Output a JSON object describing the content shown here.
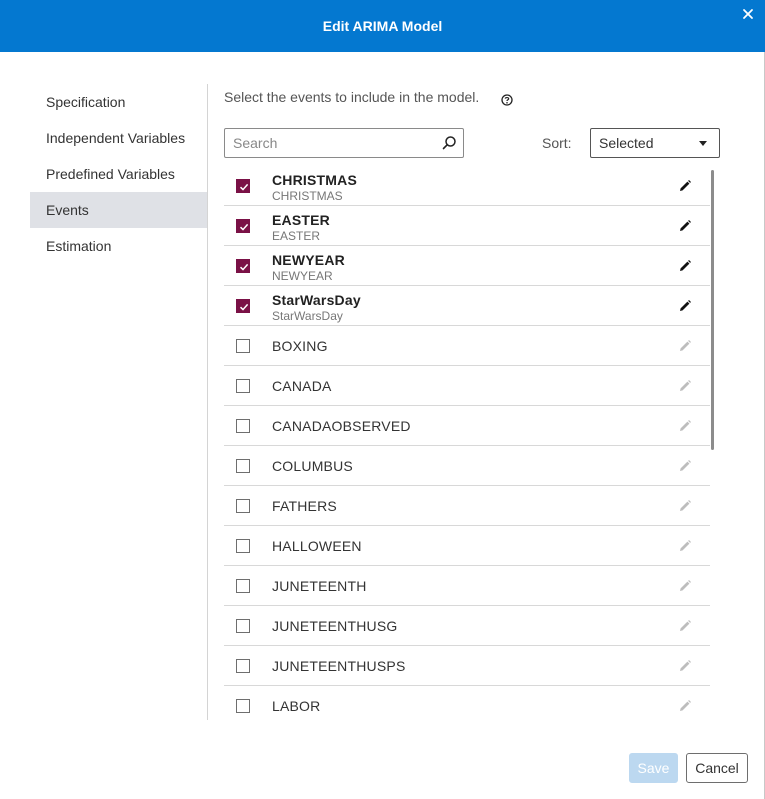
{
  "dialog": {
    "title": "Edit ARIMA Model",
    "accent_color": "#0478d0"
  },
  "nav": {
    "items": [
      {
        "label": "Specification",
        "active": false
      },
      {
        "label": "Independent Variables",
        "active": false
      },
      {
        "label": "Predefined Variables",
        "active": false
      },
      {
        "label": "Events",
        "active": true
      },
      {
        "label": "Estimation",
        "active": false
      }
    ]
  },
  "events_panel": {
    "instruction": "Select the events to include in the model.",
    "help_icon": "help-icon",
    "search": {
      "placeholder": "Search",
      "value": ""
    },
    "sort": {
      "label": "Sort:",
      "selected": "Selected"
    },
    "checkbox_color": "#7a1146",
    "rows": [
      {
        "name": "CHRISTMAS",
        "sub": "CHRISTMAS",
        "checked": true
      },
      {
        "name": "EASTER",
        "sub": "EASTER",
        "checked": true
      },
      {
        "name": "NEWYEAR",
        "sub": "NEWYEAR",
        "checked": true
      },
      {
        "name": "StarWarsDay",
        "sub": "StarWarsDay",
        "checked": true
      },
      {
        "name": "BOXING",
        "sub": "",
        "checked": false
      },
      {
        "name": "CANADA",
        "sub": "",
        "checked": false
      },
      {
        "name": "CANADAOBSERVED",
        "sub": "",
        "checked": false
      },
      {
        "name": "COLUMBUS",
        "sub": "",
        "checked": false
      },
      {
        "name": "FATHERS",
        "sub": "",
        "checked": false
      },
      {
        "name": "HALLOWEEN",
        "sub": "",
        "checked": false
      },
      {
        "name": "JUNETEENTH",
        "sub": "",
        "checked": false
      },
      {
        "name": "JUNETEENTHUSG",
        "sub": "",
        "checked": false
      },
      {
        "name": "JUNETEENTHUSPS",
        "sub": "",
        "checked": false
      },
      {
        "name": "LABOR",
        "sub": "",
        "checked": false
      }
    ]
  },
  "footer": {
    "save_label": "Save",
    "cancel_label": "Cancel"
  }
}
